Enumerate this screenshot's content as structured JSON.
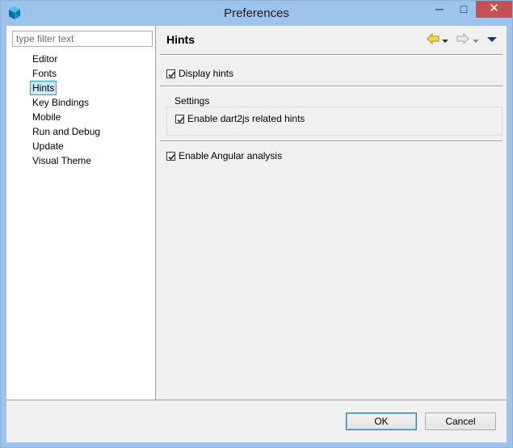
{
  "window": {
    "title": "Preferences",
    "minimize": "─",
    "maximize": "□",
    "close": "✕"
  },
  "sidebar": {
    "filter_placeholder": "type filter text",
    "items": [
      {
        "label": "Editor"
      },
      {
        "label": "Fonts"
      },
      {
        "label": "Hints",
        "selected": true
      },
      {
        "label": "Key Bindings"
      },
      {
        "label": "Mobile"
      },
      {
        "label": "Run and Debug"
      },
      {
        "label": "Update"
      },
      {
        "label": "Visual Theme"
      }
    ]
  },
  "page": {
    "title": "Hints",
    "nav_icons": [
      "back-arrow-icon",
      "back-dropdown-icon",
      "forward-arrow-icon",
      "forward-dropdown-icon",
      "view-menu-icon"
    ],
    "display_hints": {
      "label": "Display hints",
      "checked": true
    },
    "settings_group": {
      "label": "Settings",
      "dart2js": {
        "label": "Enable dart2js related hints",
        "checked": true
      }
    },
    "angular": {
      "label": "Enable Angular analysis",
      "checked": true
    }
  },
  "buttons": {
    "ok": "OK",
    "cancel": "Cancel"
  },
  "colors": {
    "titlebar": "#9cc3eb",
    "close_button": "#c75050",
    "selection_bg": "#cbe8f6",
    "selection_border": "#26a0da"
  }
}
